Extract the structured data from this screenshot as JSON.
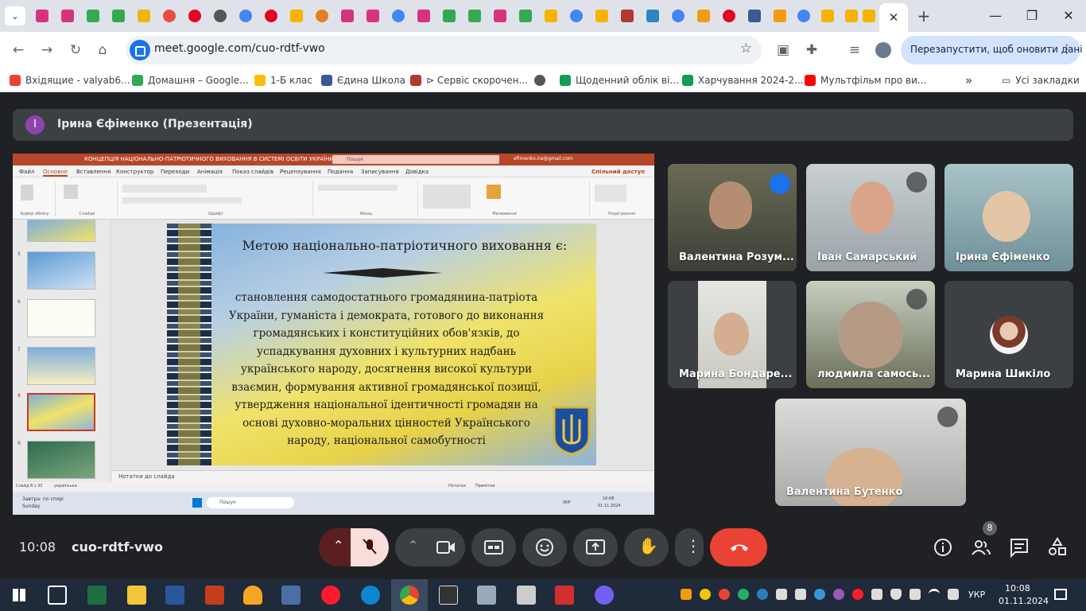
{
  "browser": {
    "tab_menu_icon": "chevron-down-icon",
    "close_tab_glyph": "✕",
    "new_tab_glyph": "+",
    "window_controls": {
      "minimize": "—",
      "maximize": "❐",
      "close": "✕"
    },
    "url": "meet.google.com/cuo-rdtf-vwo",
    "restart_label": "Перезапустити, щоб оновити дані",
    "restart_menu": "⋮",
    "bookmarks": [
      {
        "label": "Вхідящие - valyab6...",
        "color": "#ea4335"
      },
      {
        "label": "Домашня – Google...",
        "color": "#34a853"
      },
      {
        "label": "1-Б клас",
        "color": "#fbbc04"
      },
      {
        "label": "Єдина Школа",
        "color": "#3b5998"
      },
      {
        "label": "⊳ Сервіс скорочен...",
        "color": "#b03a2e"
      },
      {
        "label": "",
        "color": "#555555"
      },
      {
        "label": "Щоденний облік ві...",
        "color": "#0f9d58"
      },
      {
        "label": "Харчування 2024-2...",
        "color": "#0f9d58"
      },
      {
        "label": "Мультфільм про ви...",
        "color": "#ff0000"
      }
    ],
    "bookmarks_more": "»",
    "all_bookmarks": "Усі закладки"
  },
  "meet": {
    "presenter_initial": "І",
    "presenter_label": "Ірина Єфіменко (Презентація)",
    "time": "10:08",
    "meeting_code": "cuo-rdtf-vwo",
    "participant_count": "8",
    "participants": [
      {
        "name": "Валентина Розум...",
        "speaking": true,
        "bg": "#4a4e40"
      },
      {
        "name": "Іван Самарський",
        "speaking": false,
        "bg": "#9aa3a8"
      },
      {
        "name": "Ірина Єфіменко",
        "speaking": false,
        "bg": "#7fa0a8"
      },
      {
        "name": "Марина Бондаре...",
        "speaking": false,
        "bg": "#5a5e60"
      },
      {
        "name": "людмила самось...",
        "speaking": false,
        "bg": "#6a6e5a"
      },
      {
        "name": "Марина Шикіло",
        "speaking": false,
        "bg": "#3c4043"
      },
      {
        "name": "Валентина Бутенко",
        "speaking": false,
        "bg": "#8a8e8c"
      }
    ]
  },
  "powerpoint": {
    "title": "КОНЦЕПЦІЯ НАЦІОНАЛЬНО-ПАТРІОТИЧНОГО ВИХОВАННЯ В СИСТЕМІ ОСВІТИ УКРАЇНИ  -  PowerPoint",
    "search": "Пошук",
    "email": "efimenko.ira@gmail.com",
    "menu": [
      "Файл",
      "Основне",
      "Вставлення",
      "Конструктор",
      "Переходи",
      "Анімація",
      "Показ слайдів",
      "Рецензування",
      "Подання",
      "Записування",
      "Довідка"
    ],
    "share": "Спільний доступ",
    "ribbon_groups": [
      "Буфер обміну",
      "Слайди",
      "Шрифт",
      "Абзац",
      "Малювання",
      "Редагування"
    ],
    "thumb_numbers": [
      "5",
      "6",
      "7",
      "8",
      "9"
    ],
    "notes": "Нотатки до слайда",
    "status_left": "Слайд 8 з 32",
    "status_lang": "українська",
    "status_notes": "Нотатки",
    "status_comments": "Примітки",
    "taskbar_weather": "Завтра: по спорі",
    "taskbar_weather_day": "Sunday",
    "taskbar_search": "Пошук",
    "taskbar_lang": "УКР",
    "taskbar_time": "10:08",
    "taskbar_date": "01.11.2024"
  },
  "slide": {
    "title": "Метою національно-патріотичного виховання є:",
    "body": "становлення самодостатнього громадянина-патріота України, гуманіста і демократа, готового до виконання громадянських і конституційних обов'язків, до успадкування духовних і культурних надбань українського народу, досягнення високої культури взаємин, формування активної громадянської позиції, утвердження національної ідентичності громадян на основі духовно-моральних цінностей Українського народу, національної самобутності"
  },
  "taskbar": {
    "lang": "УКР",
    "time": "10:08",
    "date": "01.11.2024"
  }
}
